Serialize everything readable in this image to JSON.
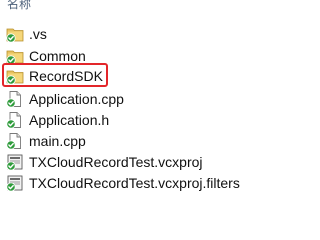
{
  "header": {
    "name_column": "名称"
  },
  "files": [
    {
      "name": ".vs",
      "icon": "folder-icon",
      "status": "tracked-checkmark"
    },
    {
      "name": "Common",
      "icon": "folder-icon",
      "status": "tracked-checkmark"
    },
    {
      "name": "RecordSDK",
      "icon": "folder-icon",
      "status": "tracked-checkmark",
      "highlighted": true
    },
    {
      "name": "Application.cpp",
      "icon": "document-icon",
      "status": "tracked-checkmark"
    },
    {
      "name": "Application.h",
      "icon": "document-icon",
      "status": "tracked-checkmark"
    },
    {
      "name": "main.cpp",
      "icon": "document-icon",
      "status": "tracked-checkmark"
    },
    {
      "name": "TXCloudRecordTest.vcxproj",
      "icon": "project-file-icon",
      "status": "tracked-checkmark"
    },
    {
      "name": "TXCloudRecordTest.vcxproj.filters",
      "icon": "project-file-icon",
      "status": "tracked-checkmark"
    }
  ],
  "colors": {
    "highlight_border": "#e3262a",
    "check_badge": "#2e9b3b",
    "folder": "#e8c260",
    "text": "#111111"
  }
}
